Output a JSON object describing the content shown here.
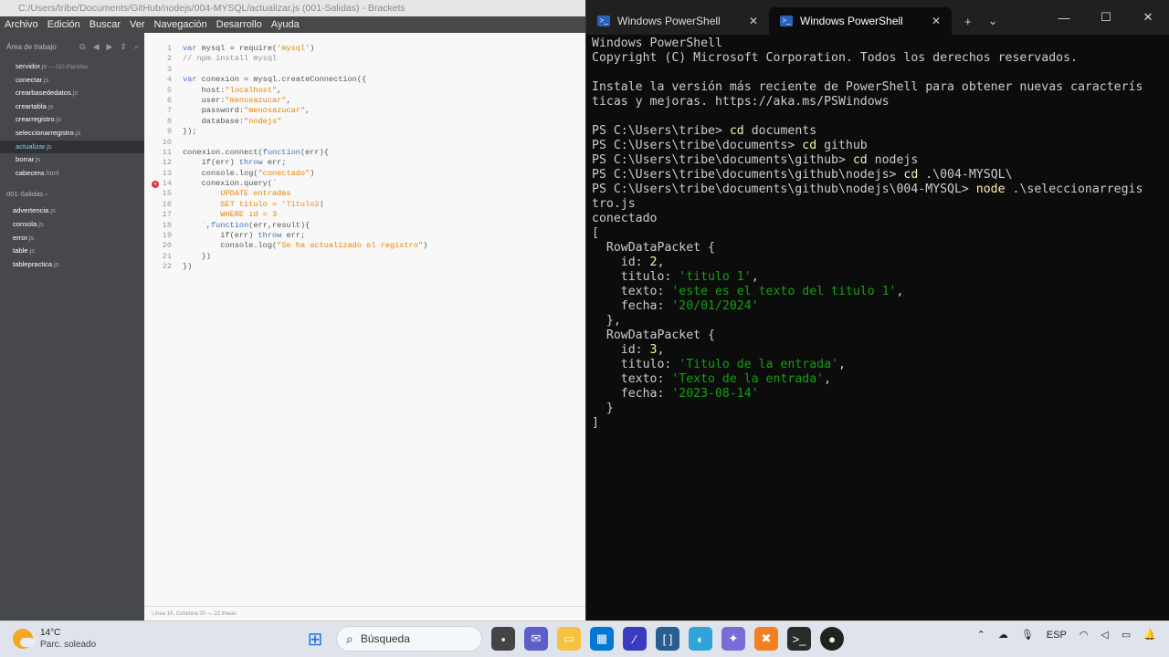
{
  "brackets": {
    "title": "C:/Users/tribe/Documents/GitHub/nodejs/004-MYSQL/actualizar.js (001-Salidas) - Brackets",
    "menu": [
      "Archivo",
      "Edición",
      "Buscar",
      "Ver",
      "Navegación",
      "Desarrollo",
      "Ayuda"
    ],
    "workarea_label": "Área de trabajo",
    "files": [
      {
        "name": "servidor",
        "ext": ".js",
        "note": " — 010-Plantillas"
      },
      {
        "name": "conectar",
        "ext": ".js",
        "note": ""
      },
      {
        "name": "crearbasededatos",
        "ext": ".js",
        "note": ""
      },
      {
        "name": "creartabla",
        "ext": ".js",
        "note": ""
      },
      {
        "name": "crearregistro",
        "ext": ".js",
        "note": ""
      },
      {
        "name": "seleccionarregistro",
        "ext": ".js",
        "note": ""
      },
      {
        "name": "actualizar",
        "ext": ".js",
        "note": ""
      },
      {
        "name": "borrar",
        "ext": ".js",
        "note": ""
      },
      {
        "name": "cabecera",
        "ext": ".html",
        "note": ""
      }
    ],
    "project_label": "001-Salidas ›",
    "project_files": [
      {
        "name": "advertencia",
        "ext": ".js"
      },
      {
        "name": "consola",
        "ext": ".js"
      },
      {
        "name": "error",
        "ext": ".js"
      },
      {
        "name": "table",
        "ext": ".js"
      },
      {
        "name": "tablepractica",
        "ext": ".js"
      }
    ],
    "code_lines": [
      [
        [
          "kw",
          "var "
        ],
        [
          "pl",
          "mysql = require("
        ],
        [
          "st",
          "'mysql'"
        ],
        [
          "pl",
          ")"
        ]
      ],
      [
        [
          "cm",
          "// npm install mysql"
        ]
      ],
      [],
      [
        [
          "kw",
          "var "
        ],
        [
          "pl",
          "conexion = mysql.createConnection({"
        ]
      ],
      [
        [
          "pl",
          "    host:"
        ],
        [
          "st",
          "\"localhost\""
        ],
        [
          "pl",
          ","
        ]
      ],
      [
        [
          "pl",
          "    user:"
        ],
        [
          "st",
          "\"menosazucar\""
        ],
        [
          "pl",
          ","
        ]
      ],
      [
        [
          "pl",
          "    password:"
        ],
        [
          "st",
          "\"menosazucar\""
        ],
        [
          "pl",
          ","
        ]
      ],
      [
        [
          "pl",
          "    database:"
        ],
        [
          "st",
          "\"nodejs\""
        ]
      ],
      [
        [
          "pl",
          "});"
        ]
      ],
      [],
      [
        [
          "pl",
          "conexion.connect("
        ],
        [
          "kw",
          "function"
        ],
        [
          "pl",
          "(err){"
        ]
      ],
      [
        [
          "pl",
          "    if(err) "
        ],
        [
          "kw",
          "throw "
        ],
        [
          "pl",
          "err;"
        ]
      ],
      [
        [
          "pl",
          "    console.log("
        ],
        [
          "st",
          "\"conectado\""
        ],
        [
          "pl",
          ")"
        ]
      ],
      [
        [
          "pl",
          "    conexion.query(`"
        ]
      ],
      [
        [
          "st",
          "        UPDATE entradas"
        ]
      ],
      [
        [
          "st",
          "        SET titulo = 'Titulo2"
        ],
        [
          "pl",
          "|"
        ]
      ],
      [
        [
          "st",
          "        WHERE id = 3"
        ]
      ],
      [
        [
          "st",
          "    `"
        ],
        [
          "pl",
          ","
        ],
        [
          "kw",
          "function"
        ],
        [
          "pl",
          "(err,result){"
        ]
      ],
      [
        [
          "pl",
          "        if(err) "
        ],
        [
          "kw",
          "throw "
        ],
        [
          "pl",
          "err;"
        ]
      ],
      [
        [
          "pl",
          "        console.log("
        ],
        [
          "st",
          "\"Se ha actualizado el registro\""
        ],
        [
          "pl",
          ")"
        ]
      ],
      [
        [
          "pl",
          "    })"
        ]
      ],
      [
        [
          "pl",
          "})"
        ]
      ]
    ],
    "error_line": 14,
    "status": "Línea 16, Columna 30 — 22 líneas"
  },
  "terminal": {
    "tabs": [
      "Windows PowerShell",
      "Windows PowerShell"
    ],
    "lines": [
      [
        [
          "tgr",
          "Windows PowerShell"
        ]
      ],
      [
        [
          "tgr",
          "Copyright (C) Microsoft Corporation. Todos los derechos reservados."
        ]
      ],
      [],
      [
        [
          "tgr",
          "Instale la versión más reciente de PowerShell para obtener nuevas caracterís"
        ]
      ],
      [
        [
          "tgr",
          "ticas y mejoras. https://aka.ms/PSWindows"
        ]
      ],
      [],
      [
        [
          "tgr",
          "PS C:\\Users\\tribe> "
        ],
        [
          "ty",
          "cd "
        ],
        [
          "tgr",
          "documents"
        ]
      ],
      [
        [
          "tgr",
          "PS C:\\Users\\tribe\\documents> "
        ],
        [
          "ty",
          "cd "
        ],
        [
          "tgr",
          "github"
        ]
      ],
      [
        [
          "tgr",
          "PS C:\\Users\\tribe\\documents\\github> "
        ],
        [
          "ty",
          "cd "
        ],
        [
          "tgr",
          "nodejs"
        ]
      ],
      [
        [
          "tgr",
          "PS C:\\Users\\tribe\\documents\\github\\nodejs> "
        ],
        [
          "ty",
          "cd "
        ],
        [
          "tgr",
          ".\\004-MYSQL\\"
        ]
      ],
      [
        [
          "tgr",
          "PS C:\\Users\\tribe\\documents\\github\\nodejs\\004-MYSQL> "
        ],
        [
          "ty",
          "node "
        ],
        [
          "tgr",
          ".\\seleccionarregis"
        ]
      ],
      [
        [
          "tgr",
          "tro.js"
        ]
      ],
      [
        [
          "tgr",
          "conectado"
        ]
      ],
      [
        [
          "tgr",
          "["
        ]
      ],
      [
        [
          "tgr",
          "  RowDataPacket {"
        ]
      ],
      [
        [
          "tgr",
          "    id: "
        ],
        [
          "ty",
          "2"
        ],
        [
          "tgr",
          ","
        ]
      ],
      [
        [
          "tgr",
          "    titulo: "
        ],
        [
          "tg",
          "'titulo 1'"
        ],
        [
          "tgr",
          ","
        ]
      ],
      [
        [
          "tgr",
          "    texto: "
        ],
        [
          "tg",
          "'este es el texto del titulo 1'"
        ],
        [
          "tgr",
          ","
        ]
      ],
      [
        [
          "tgr",
          "    fecha: "
        ],
        [
          "tg",
          "'20/01/2024'"
        ]
      ],
      [
        [
          "tgr",
          "  },"
        ]
      ],
      [
        [
          "tgr",
          "  RowDataPacket {"
        ]
      ],
      [
        [
          "tgr",
          "    id: "
        ],
        [
          "ty",
          "3"
        ],
        [
          "tgr",
          ","
        ]
      ],
      [
        [
          "tgr",
          "    titulo: "
        ],
        [
          "tg",
          "'Titulo de la entrada'"
        ],
        [
          "tgr",
          ","
        ]
      ],
      [
        [
          "tgr",
          "    texto: "
        ],
        [
          "tg",
          "'Texto de la entrada'"
        ],
        [
          "tgr",
          ","
        ]
      ],
      [
        [
          "tgr",
          "    fecha: "
        ],
        [
          "tg",
          "'2023-08-14'"
        ]
      ],
      [
        [
          "tgr",
          "  }"
        ]
      ],
      [
        [
          "tgr",
          "]"
        ]
      ]
    ]
  },
  "taskbar": {
    "temp": "14°C",
    "weather": "Parc. soleado",
    "search_placeholder": "Búsqueda",
    "lang": "ESP"
  }
}
